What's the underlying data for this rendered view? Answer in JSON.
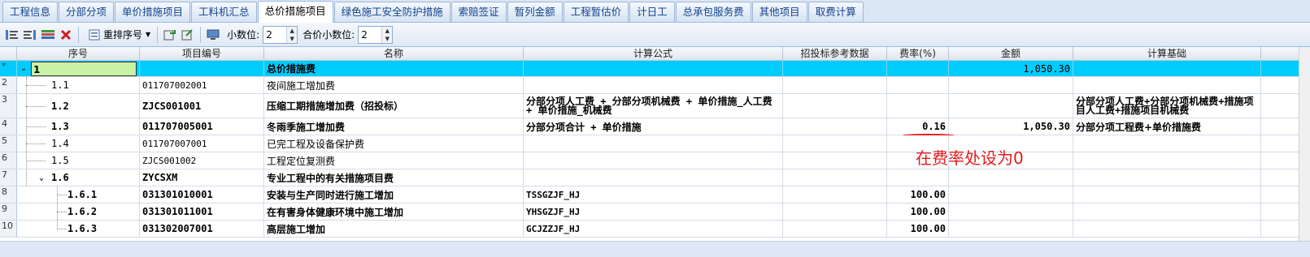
{
  "tabs": [
    "工程信息",
    "分部分项",
    "单价措施项目",
    "工料机汇总",
    "总价措施项目",
    "绿色施工安全防护措施",
    "索赔签证",
    "暂列金额",
    "工程暂估价",
    "计日工",
    "总承包服务费",
    "其他项目",
    "取费计算"
  ],
  "active_tab_index": 4,
  "toolbar": {
    "reorder_label": "重排序号",
    "decimal_label": "小数位:",
    "decimal_value": "2",
    "total_decimal_label": "合价小数位:",
    "total_decimal_value": "2"
  },
  "columns": [
    "序号",
    "项目编号",
    "名称",
    "计算公式",
    "招投标参考数据",
    "费率(%)",
    "金额",
    "计算基础"
  ],
  "rows": [
    {
      "rownum": "*",
      "seq": "1",
      "code": "",
      "name": "总价措施费",
      "formula": "",
      "ref": "",
      "rate": "",
      "amount": "1,050.30",
      "base": ""
    },
    {
      "rownum": "2",
      "seq": "1.1",
      "code": "011707002001",
      "name": "夜间施工增加费",
      "formula": "",
      "ref": "",
      "rate": "",
      "amount": "",
      "base": ""
    },
    {
      "rownum": "3",
      "seq": "1.2",
      "code": "ZJCS001001",
      "name": "压缩工期措施增加费（招投标）",
      "formula": "分部分项人工费 + 分部分项机械费 + 单价措施_人工费 + 单价措施_机械费",
      "ref": "",
      "rate": "",
      "amount": "",
      "base": "分部分项人工费+分部分项机械费+措施项目人工费+措施项目机械费"
    },
    {
      "rownum": "4",
      "seq": "1.3",
      "code": "011707005001",
      "name": "冬雨季施工增加费",
      "formula": "分部分项合计 + 单价措施",
      "ref": "",
      "rate": "0.16",
      "amount": "1,050.30",
      "base": "分部分项工程费+单价措施费"
    },
    {
      "rownum": "5",
      "seq": "1.4",
      "code": "011707007001",
      "name": "已完工程及设备保护费",
      "formula": "",
      "ref": "",
      "rate": "",
      "amount": "",
      "base": ""
    },
    {
      "rownum": "6",
      "seq": "1.5",
      "code": "ZJCS001002",
      "name": "工程定位复测费",
      "formula": "",
      "ref": "",
      "rate": "",
      "amount": "",
      "base": ""
    },
    {
      "rownum": "7",
      "seq": "1.6",
      "code": "ZYCSXM",
      "name": "专业工程中的有关措施项目费",
      "formula": "",
      "ref": "",
      "rate": "",
      "amount": "",
      "base": ""
    },
    {
      "rownum": "8",
      "seq": "1.6.1",
      "code": "031301010001",
      "name": "安装与生产同时进行施工增加",
      "formula": "TSSGZJF_HJ",
      "ref": "",
      "rate": "100.00",
      "amount": "",
      "base": ""
    },
    {
      "rownum": "9",
      "seq": "1.6.2",
      "code": "031301011001",
      "name": "在有害身体健康环境中施工增加",
      "formula": "YHSGZJF_HJ",
      "ref": "",
      "rate": "100.00",
      "amount": "",
      "base": ""
    },
    {
      "rownum": "10",
      "seq": "1.6.3",
      "code": "031302007001",
      "name": "高层施工增加",
      "formula": "GCJZZJF_HJ",
      "ref": "",
      "rate": "100.00",
      "amount": "",
      "base": ""
    }
  ],
  "annotation": "在费率处设为0",
  "colors": {
    "selected_row": "#00ccff",
    "first_seq_cell": "#c9f2a5",
    "annotation": "#e31b1b"
  }
}
